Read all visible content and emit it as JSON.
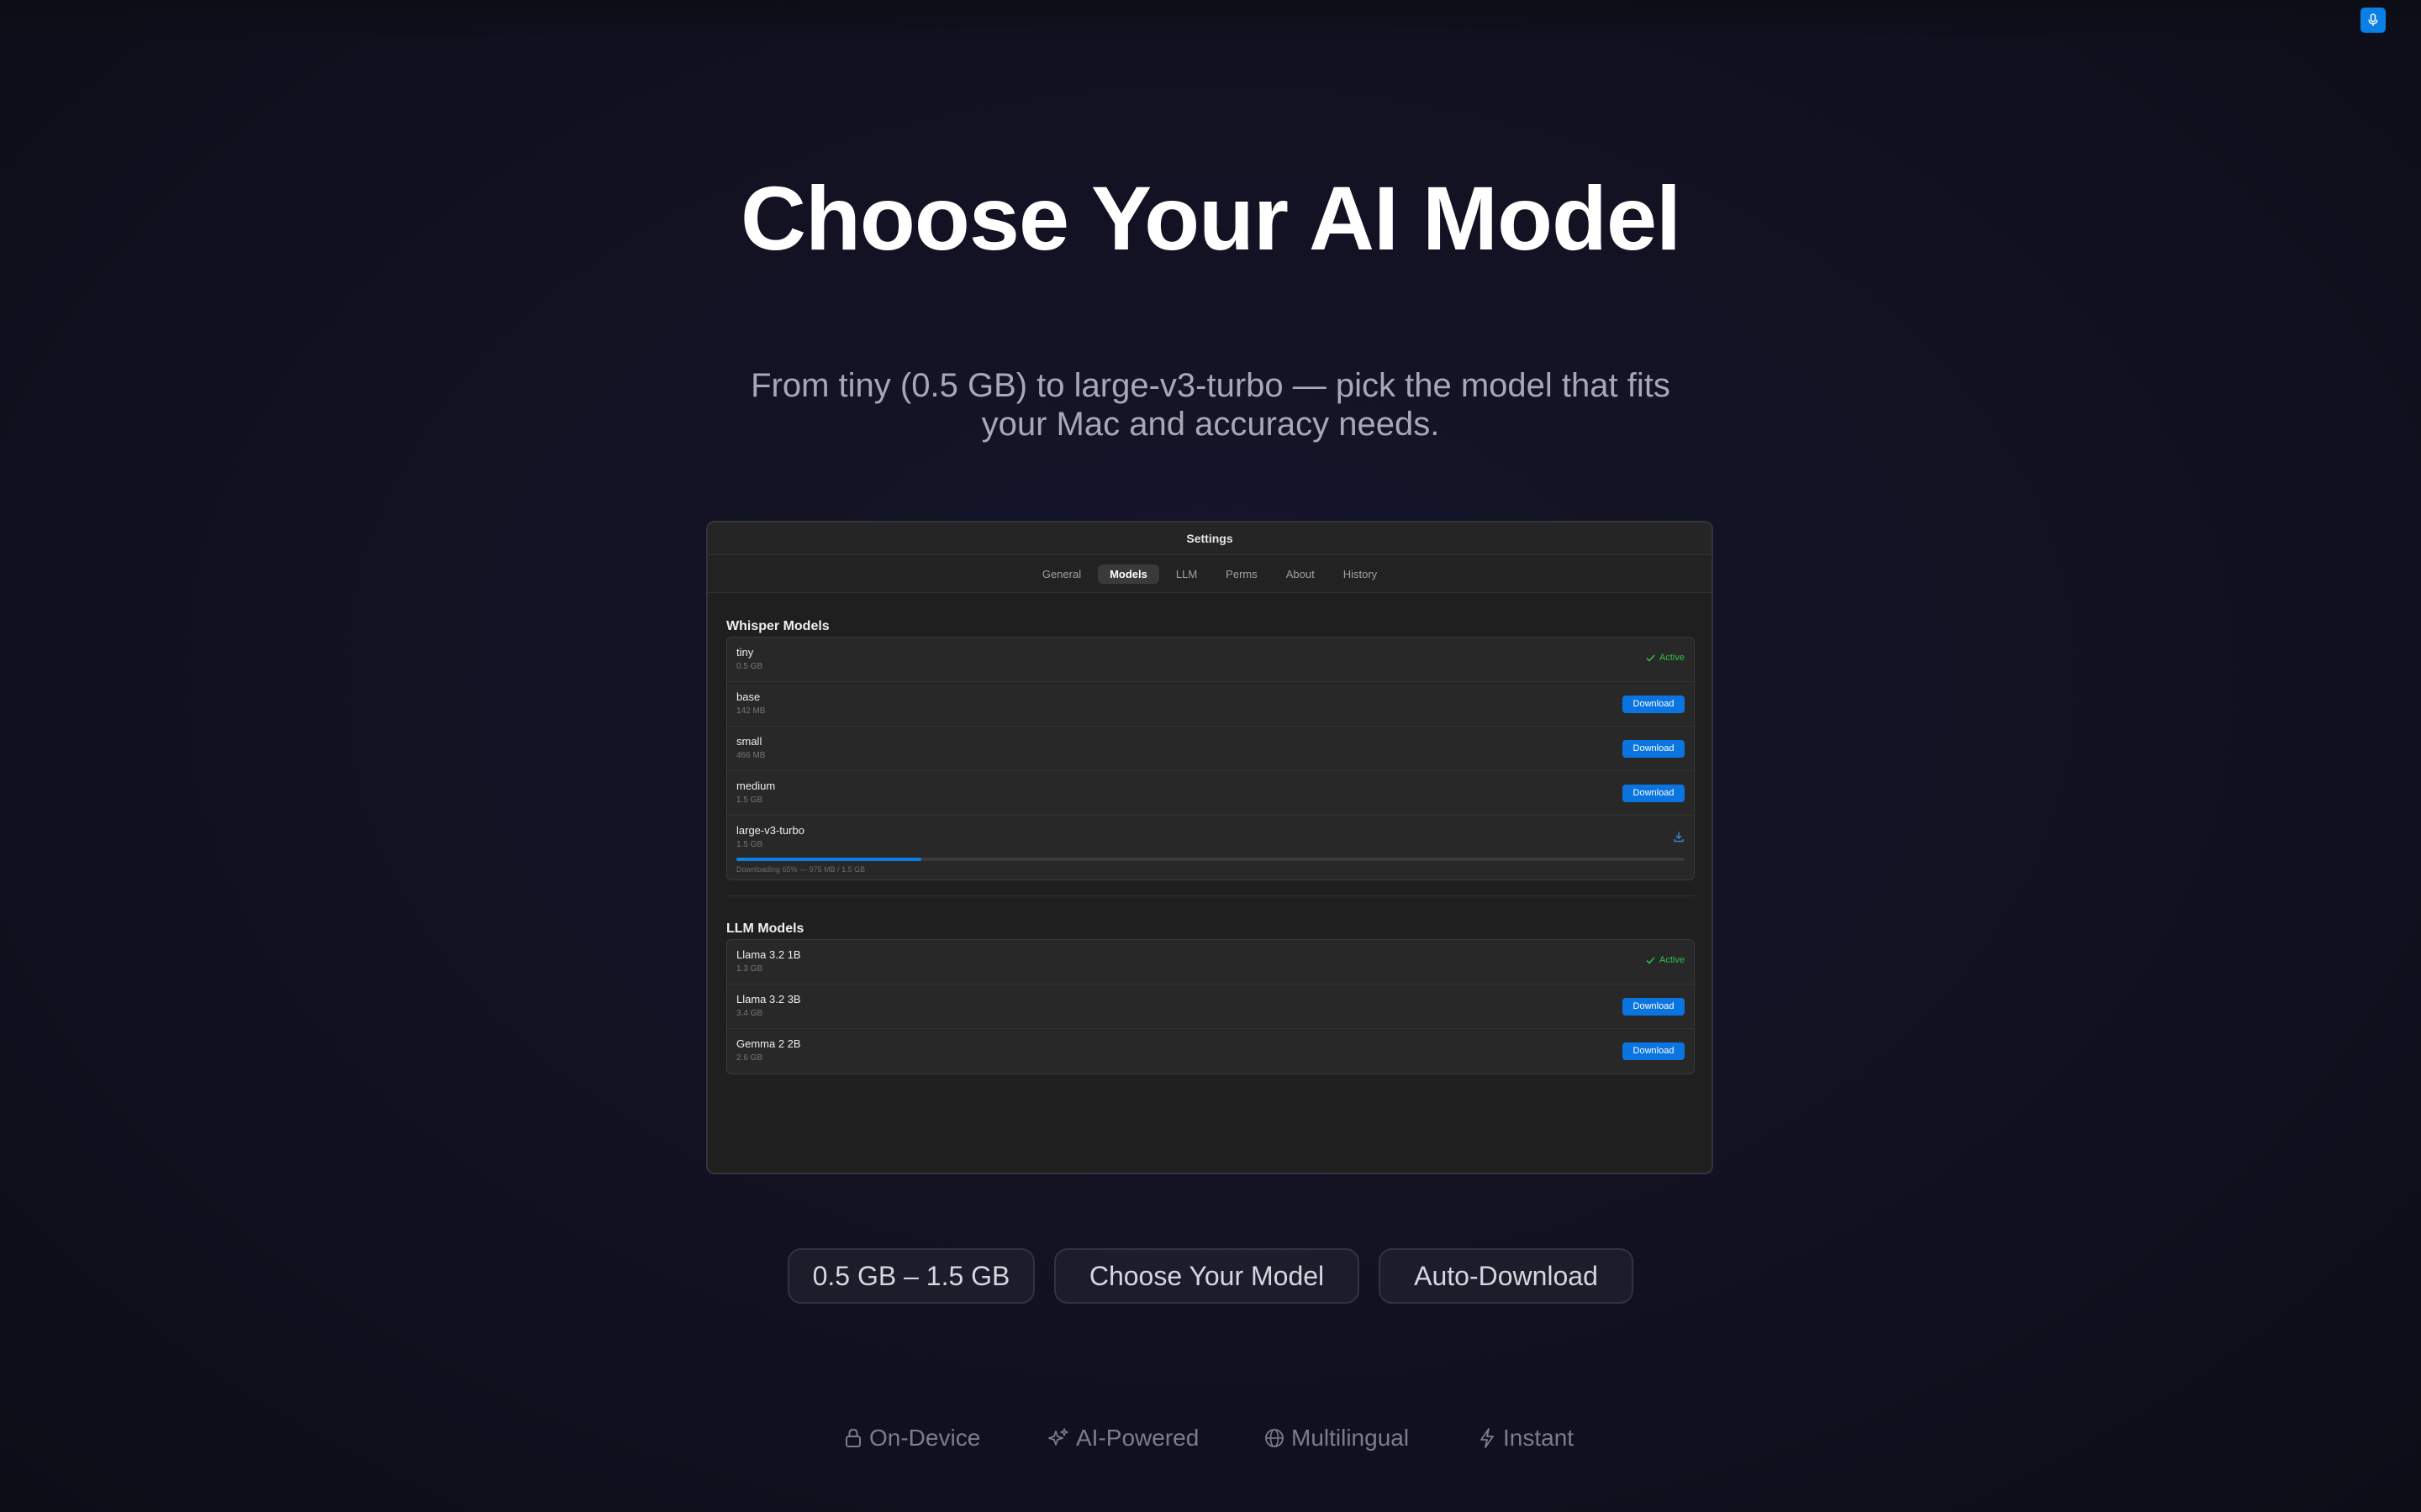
{
  "hero": {
    "title": "Choose Your AI Model",
    "subtitle_line1": "From tiny (0.5 GB) to large-v3-turbo — pick the model that fits",
    "subtitle_line2": "your Mac and accuracy needs."
  },
  "header": {
    "mic_icon": "microphone-icon",
    "accent_color": "#0a7fe5"
  },
  "settings_window": {
    "title": "Settings",
    "tabs": [
      {
        "label": "General",
        "active": false
      },
      {
        "label": "Models",
        "active": true
      },
      {
        "label": "LLM",
        "active": false
      },
      {
        "label": "Perms",
        "active": false
      },
      {
        "label": "About",
        "active": false
      },
      {
        "label": "History",
        "active": false
      }
    ],
    "whisper_section": {
      "title": "Whisper Models",
      "models": [
        {
          "name": "tiny",
          "size": "0.5 GB",
          "status": "Active"
        },
        {
          "name": "base",
          "size": "142 MB",
          "action": "Download"
        },
        {
          "name": "small",
          "size": "466 MB",
          "action": "Download"
        },
        {
          "name": "medium",
          "size": "1.5 GB",
          "action": "Download"
        },
        {
          "name": "large-v3-turbo",
          "size": "1.5 GB",
          "status_icon": "download-icon",
          "progress": 0.65,
          "progress_text": "Downloading 65% — 975 MB / 1.5 GB"
        }
      ]
    },
    "llm_section": {
      "title": "LLM Models",
      "models": [
        {
          "name": "Llama 3.2 1B",
          "size": "1.3 GB",
          "status": "Active"
        },
        {
          "name": "Llama 3.2 3B",
          "size": "3.4 GB",
          "action": "Download"
        },
        {
          "name": "Gemma 2 2B",
          "size": "2.6 GB",
          "action": "Download"
        }
      ]
    },
    "status_color_active": "#30c24a",
    "button_color": "#0a74e0"
  },
  "pills": [
    "0.5 GB – 1.5 GB",
    "Choose Your Model",
    "Auto-Download"
  ],
  "features": [
    {
      "label": "On-Device",
      "icon": "lock-icon"
    },
    {
      "label": "AI-Powered",
      "icon": "sparkles-icon"
    },
    {
      "label": "Multilingual",
      "icon": "globe-icon"
    },
    {
      "label": "Instant",
      "icon": "lightning-icon"
    }
  ]
}
